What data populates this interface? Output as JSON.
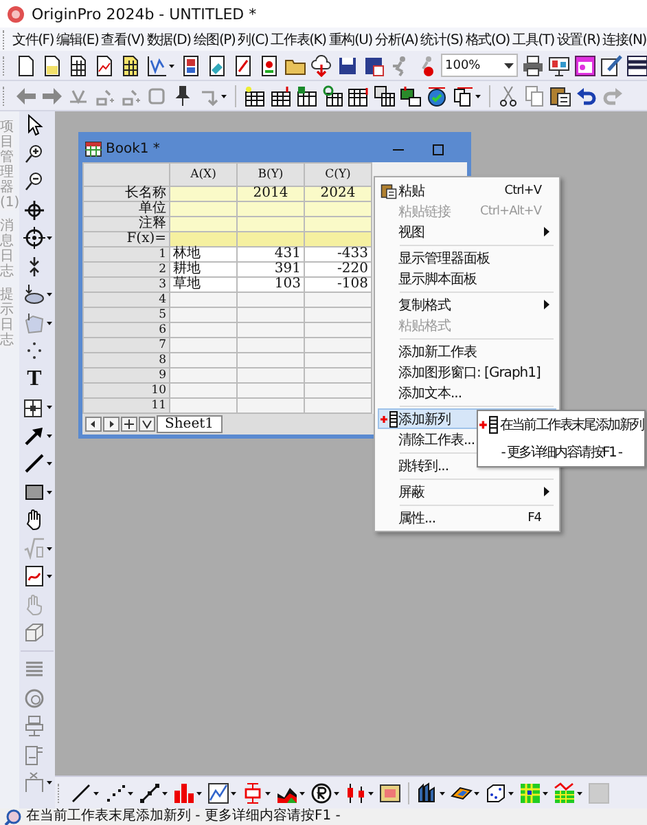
{
  "window": {
    "title": "OriginPro 2024b - UNTITLED *"
  },
  "menu_bar": [
    {
      "label": "文件(F)"
    },
    {
      "label": "编辑(E)"
    },
    {
      "label": "查看(V)"
    },
    {
      "label": "数据(D)"
    },
    {
      "label": "绘图(P)"
    },
    {
      "label": "列(C)"
    },
    {
      "label": "工作表(K)"
    },
    {
      "label": "重构(U)"
    },
    {
      "label": "分析(A)"
    },
    {
      "label": "统计(S)"
    },
    {
      "label": "格式(O)"
    },
    {
      "label": "工具(T)"
    },
    {
      "label": "设置(R)"
    },
    {
      "label": "连接(N)"
    }
  ],
  "zoom_combo": {
    "value": "100%"
  },
  "side_tabs": [
    {
      "label": "项目管理器 (1)"
    },
    {
      "label": "消息日志"
    },
    {
      "label": "提示日志"
    }
  ],
  "left_toolbar": {
    "text_tool": "T"
  },
  "workbook": {
    "title": "Book1 *",
    "columns": [
      "A(X)",
      "B(Y)",
      "C(Y)"
    ],
    "label_rows": [
      {
        "label": "长名称",
        "cells": [
          null,
          "2014",
          "2024"
        ]
      },
      {
        "label": "单位"
      },
      {
        "label": "注释"
      },
      {
        "label": "F(x)="
      }
    ],
    "rows": [
      {
        "row": "1",
        "cells": [
          "林地",
          "431",
          "-433"
        ]
      },
      {
        "row": "2",
        "cells": [
          "耕地",
          "391",
          "-220"
        ]
      },
      {
        "row": "3",
        "cells": [
          "草地",
          "103",
          "-108"
        ]
      },
      {
        "row": "4"
      },
      {
        "row": "5"
      },
      {
        "row": "6"
      },
      {
        "row": "7"
      },
      {
        "row": "8"
      },
      {
        "row": "9"
      },
      {
        "row": "10"
      },
      {
        "row": "11"
      }
    ],
    "sheet_tabs": [
      {
        "label": "Sheet1",
        "selected": true
      }
    ]
  },
  "context_menu": [
    {
      "kind": "item",
      "label": "粘贴",
      "shortcut": "Ctrl+V",
      "disabled": false,
      "selected": false
    },
    {
      "kind": "item",
      "label": "粘贴链接",
      "shortcut": "Ctrl+Alt+V",
      "disabled": true,
      "selected": false
    },
    {
      "kind": "item",
      "label": "视图",
      "disabled": false,
      "selected": false,
      "submenu": true
    },
    {
      "kind": "separator"
    },
    {
      "kind": "item",
      "label": "显示管理器面板",
      "disabled": false,
      "selected": false
    },
    {
      "kind": "item",
      "label": "显示脚本面板",
      "disabled": false,
      "selected": false
    },
    {
      "kind": "separator"
    },
    {
      "kind": "item",
      "label": "复制格式",
      "disabled": false,
      "selected": false,
      "submenu": true
    },
    {
      "kind": "item",
      "label": "粘贴格式",
      "disabled": true,
      "selected": false
    },
    {
      "kind": "separator"
    },
    {
      "kind": "item",
      "label": "添加新工作表",
      "disabled": false,
      "selected": false
    },
    {
      "kind": "item",
      "label": "添加图形窗口: [Graph1]",
      "disabled": false,
      "selected": false
    },
    {
      "kind": "item",
      "label": "添加文本...",
      "disabled": false,
      "selected": false
    },
    {
      "kind": "separator"
    },
    {
      "kind": "item",
      "label": "添加新列",
      "disabled": false,
      "selected": true
    },
    {
      "kind": "item",
      "label": "清除工作表...",
      "disabled": false,
      "selected": false
    },
    {
      "kind": "separator"
    },
    {
      "kind": "item",
      "label": "跳转到...",
      "disabled": false,
      "selected": false
    },
    {
      "kind": "separator"
    },
    {
      "kind": "item",
      "label": "屏蔽",
      "disabled": false,
      "selected": false,
      "submenu": true
    },
    {
      "kind": "separator"
    },
    {
      "kind": "item",
      "label": "属性...",
      "shortcut": "F4",
      "disabled": false,
      "selected": false
    }
  ],
  "tooltip": {
    "text": "在当前工作表末尾添加新列",
    "hint": "- 更多详细内容请按F1 -"
  },
  "status_bar": {
    "text": "在当前工作表末尾添加新列  - 更多详细内容请按F1 -"
  }
}
